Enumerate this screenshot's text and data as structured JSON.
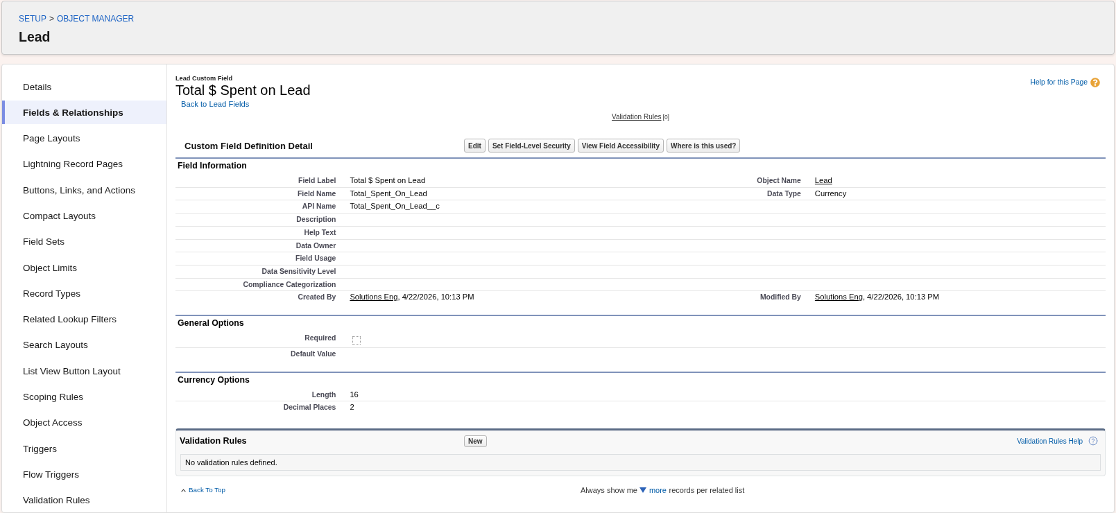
{
  "breadcrumb": {
    "items": [
      "SETUP",
      "OBJECT MANAGER"
    ],
    "separator": ">"
  },
  "object_title": "Lead",
  "sidebar": {
    "items": [
      {
        "label": "Details",
        "selected": false
      },
      {
        "label": "Fields & Relationships",
        "selected": true
      },
      {
        "label": "Page Layouts",
        "selected": false
      },
      {
        "label": "Lightning Record Pages",
        "selected": false
      },
      {
        "label": "Buttons, Links, and Actions",
        "selected": false
      },
      {
        "label": "Compact Layouts",
        "selected": false
      },
      {
        "label": "Field Sets",
        "selected": false
      },
      {
        "label": "Object Limits",
        "selected": false
      },
      {
        "label": "Record Types",
        "selected": false
      },
      {
        "label": "Related Lookup Filters",
        "selected": false
      },
      {
        "label": "Search Layouts",
        "selected": false
      },
      {
        "label": "List View Button Layout",
        "selected": false
      },
      {
        "label": "Scoping Rules",
        "selected": false
      },
      {
        "label": "Object Access",
        "selected": false
      },
      {
        "label": "Triggers",
        "selected": false
      },
      {
        "label": "Flow Triggers",
        "selected": false
      },
      {
        "label": "Validation Rules",
        "selected": false
      }
    ]
  },
  "field_header": {
    "subtitle": "Lead Custom Field",
    "title": "Total $ Spent on Lead",
    "back_link": "Back to Lead Fields",
    "help_link": "Help for this Page"
  },
  "related_links": [
    {
      "label": "Validation Rules",
      "count": "[0]"
    }
  ],
  "detail": {
    "title": "Custom Field Definition Detail",
    "buttons": [
      "Edit",
      "Set Field-Level Security",
      "View Field Accessibility",
      "Where is this used?"
    ]
  },
  "sections": [
    {
      "title": "Field Information",
      "rows": [
        {
          "cells": [
            {
              "label": "Field Label",
              "kind": "text",
              "value": "Total $ Spent on Lead"
            },
            {
              "label": "Object Name",
              "kind": "link",
              "value": "Lead"
            }
          ]
        },
        {
          "cells": [
            {
              "label": "Field Name",
              "kind": "text",
              "value": "Total_Spent_On_Lead"
            },
            {
              "label": "Data Type",
              "kind": "text",
              "value": "Currency"
            }
          ]
        },
        {
          "cells": [
            {
              "label": "API Name",
              "kind": "text",
              "value": "Total_Spent_On_Lead__c"
            }
          ]
        },
        {
          "cells": [
            {
              "label": "Description",
              "kind": "text"
            }
          ]
        },
        {
          "cells": [
            {
              "label": "Help Text",
              "kind": "text"
            }
          ]
        },
        {
          "cells": [
            {
              "label": "Data Owner",
              "kind": "text"
            }
          ]
        },
        {
          "cells": [
            {
              "label": "Field Usage",
              "kind": "text"
            }
          ]
        },
        {
          "cells": [
            {
              "label": "Data Sensitivity Level",
              "kind": "text"
            }
          ]
        },
        {
          "cells": [
            {
              "label": "Compliance Categorization",
              "kind": "text"
            }
          ]
        },
        {
          "cells": [
            {
              "label": "Created By",
              "kind": "user_stamp",
              "link": "Solutions Eng",
              "value": ", 4/22/2026, 10:13 PM"
            },
            {
              "label": "Modified By",
              "kind": "user_stamp",
              "link": "Solutions Eng",
              "value": ", 4/22/2026, 10:13 PM"
            }
          ]
        }
      ]
    },
    {
      "title": "General Options",
      "rows": [
        {
          "cells": [
            {
              "label": "Required",
              "kind": "checkbox",
              "checked": false
            }
          ]
        },
        {
          "cells": [
            {
              "label": "Default Value",
              "kind": "text"
            }
          ]
        }
      ]
    },
    {
      "title": "Currency Options",
      "rows": [
        {
          "cells": [
            {
              "label": "Length",
              "kind": "text",
              "value": "16"
            }
          ]
        },
        {
          "cells": [
            {
              "label": "Decimal Places",
              "kind": "text",
              "value": "2"
            }
          ]
        }
      ]
    }
  ],
  "related_list": {
    "title": "Validation Rules",
    "buttons": [
      "New"
    ],
    "help_link": "Validation Rules Help",
    "empty_message": "No validation rules defined."
  },
  "footer": {
    "back_to_top": "Back To Top",
    "show_more_prefix": "Always show me",
    "show_more_link": "more",
    "show_more_suffix": "records per related list"
  }
}
